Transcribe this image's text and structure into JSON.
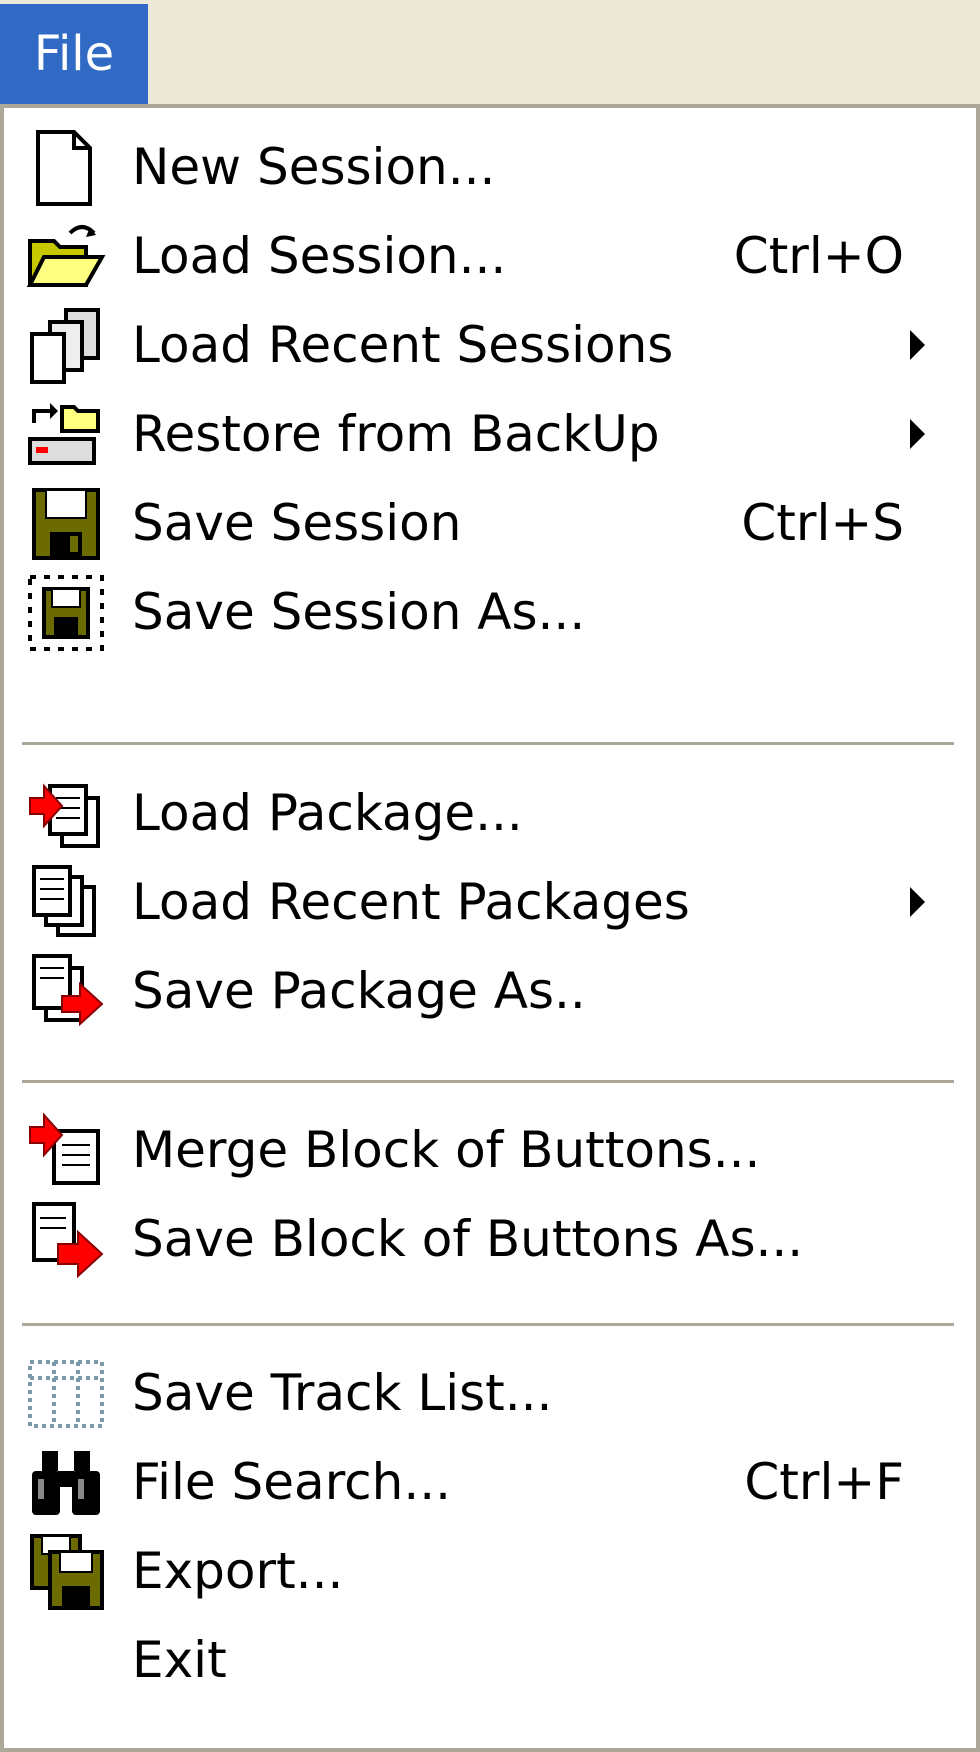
{
  "menubar": {
    "title": "File"
  },
  "menu": {
    "items": [
      {
        "label": "New Session...",
        "shortcut": "",
        "icon": "new-document-icon",
        "submenu": false
      },
      {
        "label": "Load Session...",
        "shortcut": "Ctrl+O",
        "icon": "open-folder-icon",
        "submenu": false
      },
      {
        "label": "Load Recent Sessions",
        "shortcut": "",
        "icon": "recent-documents-icon",
        "submenu": true
      },
      {
        "label": "Restore from BackUp",
        "shortcut": "",
        "icon": "restore-backup-icon",
        "submenu": true
      },
      {
        "label": "Save Session",
        "shortcut": "Ctrl+S",
        "icon": "floppy-disk-icon",
        "submenu": false
      },
      {
        "label": "Save Session As...",
        "shortcut": "",
        "icon": "floppy-disk-dashed-icon",
        "submenu": false
      },
      {
        "label": "Load Package...",
        "shortcut": "",
        "icon": "load-package-icon",
        "submenu": false
      },
      {
        "label": "Load Recent Packages",
        "shortcut": "",
        "icon": "recent-packages-icon",
        "submenu": true
      },
      {
        "label": "Save Package As..",
        "shortcut": "",
        "icon": "save-package-icon",
        "submenu": false
      },
      {
        "label": "Merge Block of Buttons...",
        "shortcut": "",
        "icon": "merge-buttons-icon",
        "submenu": false
      },
      {
        "label": "Save Block of Buttons As...",
        "shortcut": "",
        "icon": "save-buttons-icon",
        "submenu": false
      },
      {
        "label": "Save Track List...",
        "shortcut": "",
        "icon": "track-list-icon",
        "submenu": false
      },
      {
        "label": "File Search...",
        "shortcut": "Ctrl+F",
        "icon": "binoculars-icon",
        "submenu": false
      },
      {
        "label": "Export...",
        "shortcut": "",
        "icon": "export-icon",
        "submenu": false
      },
      {
        "label": "Exit",
        "shortcut": "",
        "icon": "",
        "submenu": false
      }
    ]
  },
  "colors": {
    "menu_highlight": "#316ac5",
    "menubar_bg": "#ece9d8",
    "separator": "#aca899",
    "arrow_red": "#ff0000",
    "disk_olive": "#6b6b00"
  }
}
